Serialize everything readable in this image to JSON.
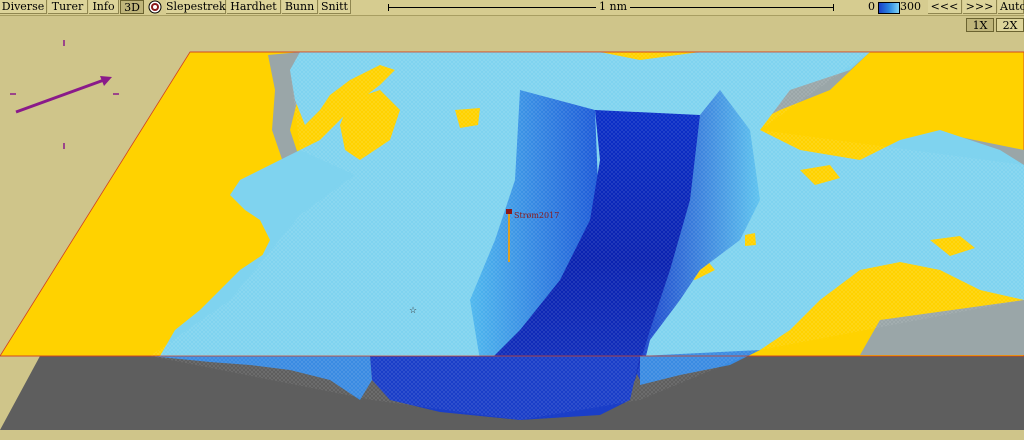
{
  "toolbar": {
    "buttons": [
      "Diverse",
      "Turer",
      "Info",
      "3D",
      "Slepestrek",
      "Hardhet",
      "Bunn",
      "Snitt"
    ],
    "active": "3D",
    "scale_label": "1 nm",
    "legend_min": "0",
    "legend_max": "300",
    "prev_label": "<<<",
    "next_label": ">>>",
    "auto_label": "Auto"
  },
  "zoom": {
    "x1": "1X",
    "x2": "2X"
  },
  "map": {
    "marker_label": "Strøm2017",
    "colors": {
      "land": "#ffd200",
      "shallow": "#7fd3ef",
      "deep": "#0a1fb8",
      "frame": "#cfc58a",
      "side_wall": "#5e5e5e",
      "heading_arrow": "#8a1a8a"
    }
  }
}
